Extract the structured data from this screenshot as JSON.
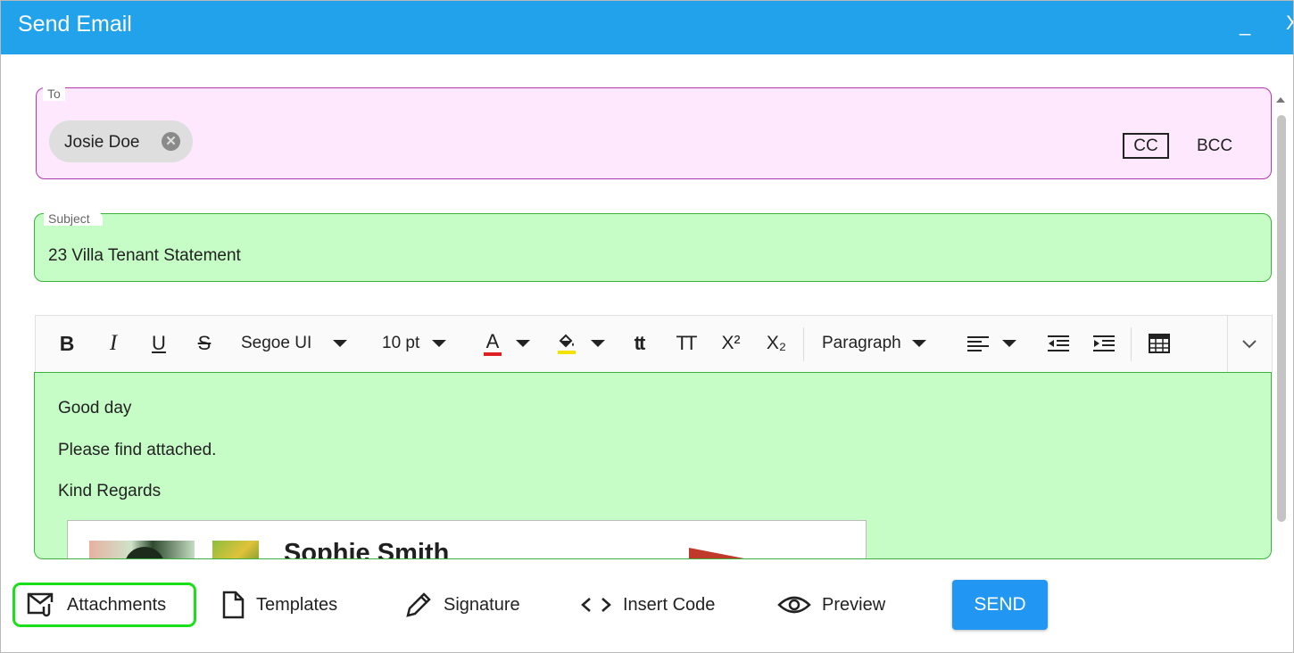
{
  "window": {
    "title": "Send Email",
    "minimize_glyph": "_",
    "close_glyph": "X"
  },
  "to": {
    "legend": "To",
    "recipients": [
      {
        "name": "Josie Doe"
      }
    ],
    "cc_label": "CC",
    "bcc_label": "BCC"
  },
  "subject": {
    "legend": "Subject",
    "value": "23 Villa Tenant Statement"
  },
  "toolbar": {
    "bold": "B",
    "italic": "I",
    "underline": "U",
    "strike": "S",
    "font_family": "Segoe UI",
    "font_size": "10 pt",
    "font_color_glyph": "A",
    "font_color": "#e02020",
    "highlight_color": "#f4e200",
    "lowercase": "tt",
    "uppercase": "TT",
    "superscript": "X²",
    "subscript": "X₂",
    "block_format": "Paragraph"
  },
  "body": {
    "lines": [
      "Good day",
      "Please find attached.",
      "Kind Regards"
    ],
    "signature_name": "Sophie Smith"
  },
  "actions": {
    "attachments": "Attachments",
    "templates": "Templates",
    "signature": "Signature",
    "insert_code": "Insert Code",
    "preview": "Preview",
    "send": "SEND"
  },
  "colors": {
    "header": "#21a2ea",
    "to_background": "#fde8fd",
    "to_border": "#b238b2",
    "subject_background": "#c6fcc6",
    "subject_border": "#3bb33b",
    "attachments_outline": "#19e019",
    "send_button": "#2196f3"
  }
}
